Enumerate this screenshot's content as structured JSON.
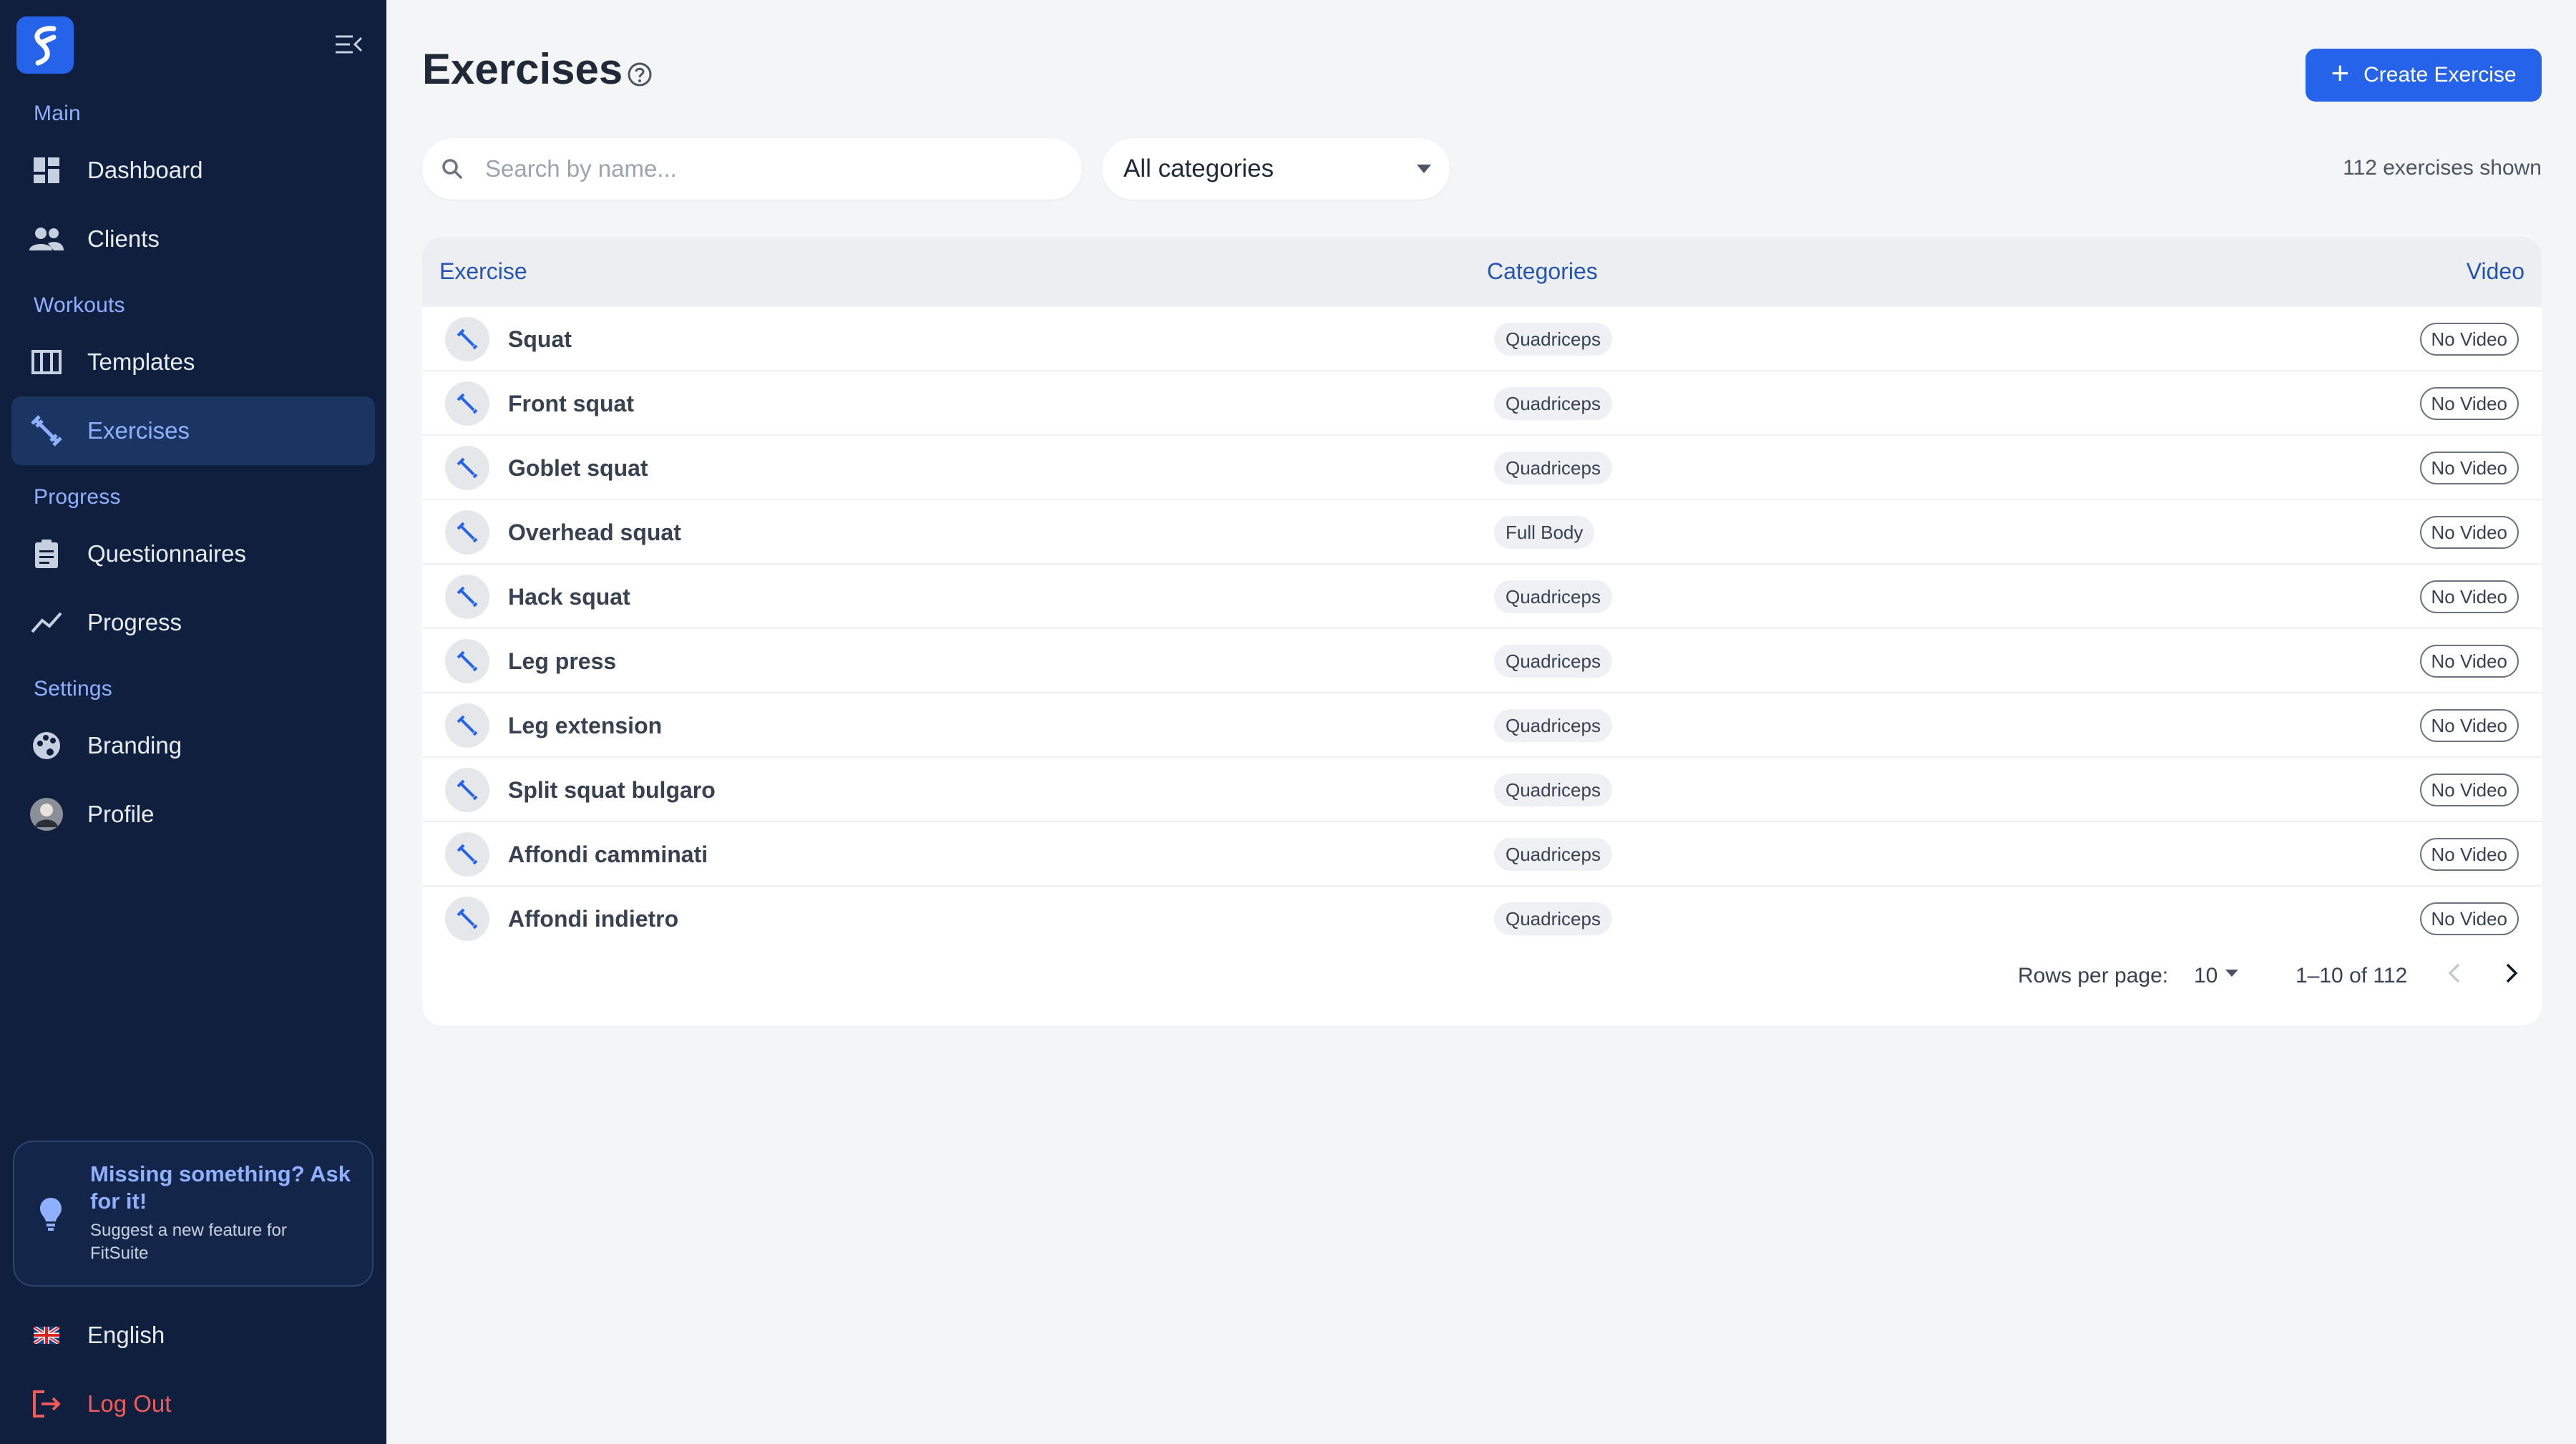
{
  "sidebar": {
    "sections": {
      "main": "Main",
      "workouts": "Workouts",
      "progress": "Progress",
      "settings": "Settings"
    },
    "items": {
      "dashboard": "Dashboard",
      "clients": "Clients",
      "templates": "Templates",
      "exercises": "Exercises",
      "questionnaires": "Questionnaires",
      "progress": "Progress",
      "branding": "Branding",
      "profile": "Profile"
    },
    "active_item": "exercises",
    "feature_card": {
      "title": "Missing something? Ask for it!",
      "subtitle": "Suggest a new feature for FitSuite"
    },
    "language": "English",
    "logout": "Log Out"
  },
  "header": {
    "title": "Exercises",
    "create_button": "Create Exercise"
  },
  "filters": {
    "search_placeholder": "Search by name...",
    "category_value": "All categories",
    "count_text": "112 exercises shown"
  },
  "table": {
    "columns": {
      "exercise": "Exercise",
      "categories": "Categories",
      "video": "Video"
    },
    "rows": [
      {
        "name": "Squat",
        "category": "Quadriceps",
        "video": "No Video"
      },
      {
        "name": "Front squat",
        "category": "Quadriceps",
        "video": "No Video"
      },
      {
        "name": "Goblet squat",
        "category": "Quadriceps",
        "video": "No Video"
      },
      {
        "name": "Overhead squat",
        "category": "Full Body",
        "video": "No Video"
      },
      {
        "name": "Hack squat",
        "category": "Quadriceps",
        "video": "No Video"
      },
      {
        "name": "Leg press",
        "category": "Quadriceps",
        "video": "No Video"
      },
      {
        "name": "Leg extension",
        "category": "Quadriceps",
        "video": "No Video"
      },
      {
        "name": "Split squat bulgaro",
        "category": "Quadriceps",
        "video": "No Video"
      },
      {
        "name": "Affondi camminati",
        "category": "Quadriceps",
        "video": "No Video"
      },
      {
        "name": "Affondi indietro",
        "category": "Quadriceps",
        "video": "No Video"
      }
    ]
  },
  "pagination": {
    "rows_per_page_label": "Rows per page:",
    "rows_per_page_value": "10",
    "range": "1–10 of 112"
  },
  "colors": {
    "sidebar_bg": "#0f1f3d",
    "accent": "#2563eb",
    "logout": "#ef5a5a"
  }
}
